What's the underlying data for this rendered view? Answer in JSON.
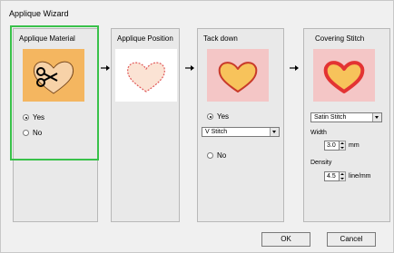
{
  "window": {
    "title": "Applique Wizard"
  },
  "panels": {
    "material": {
      "title": "Applique Material",
      "options": [
        "Yes",
        "No"
      ],
      "selected": "Yes"
    },
    "position": {
      "title": "Applique Position"
    },
    "tackdown": {
      "title": "Tack down",
      "options": [
        "Yes",
        "No"
      ],
      "selected": "Yes",
      "stitch": "V Stitch"
    },
    "covering": {
      "title": "Covering Stitch",
      "stitch": "Satin Stitch",
      "width_label": "Width",
      "width_value": "3.0",
      "width_unit": "mm",
      "density_label": "Density",
      "density_value": "4.5",
      "density_unit": "line/mm"
    }
  },
  "buttons": {
    "ok": "OK",
    "cancel": "Cancel"
  },
  "colors": {
    "accent_highlight": "#39c14a",
    "orange_bg": "#f4b660",
    "pink_bg": "#f4c6c6",
    "heart_red": "#e33333"
  },
  "icons": [
    "scissors-icon",
    "heart-icon",
    "arrow-right-icon"
  ]
}
